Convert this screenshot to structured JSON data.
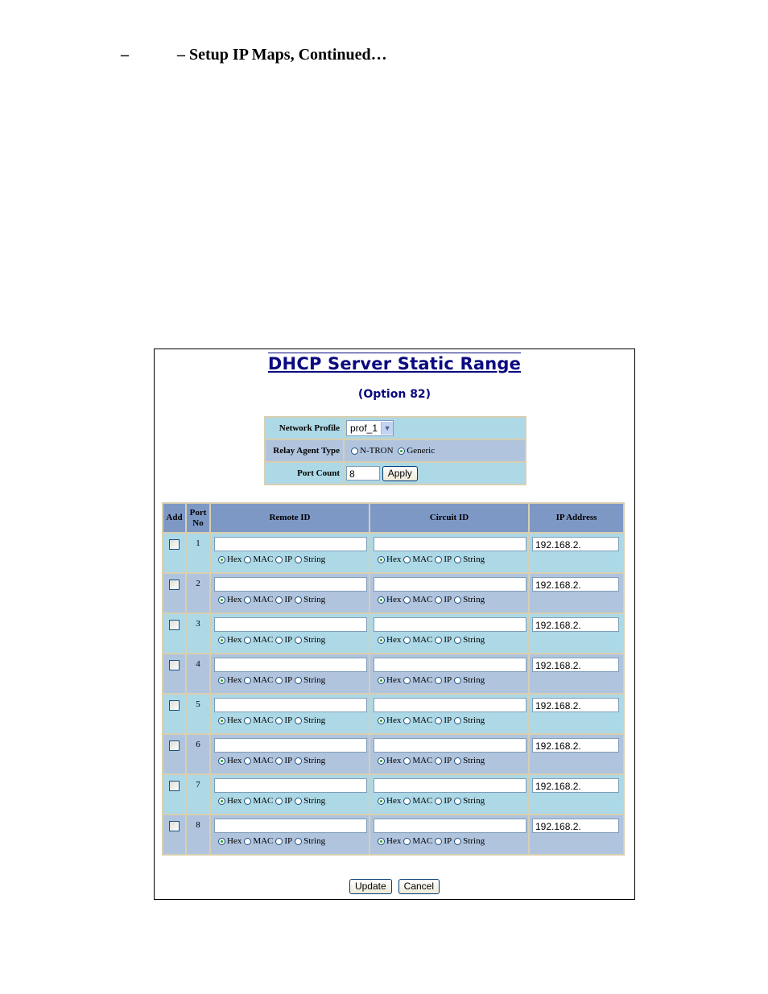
{
  "document": {
    "heading": "–            – Setup IP Maps, Continued…"
  },
  "panel": {
    "title": "DHCP Server Static Range",
    "subtitle": "(Option 82)",
    "config": {
      "network_profile_label": "Network Profile",
      "network_profile_value": "prof_1",
      "relay_agent_type_label": "Relay Agent Type",
      "relay_agent_options": [
        {
          "label": "N-TRON",
          "selected": false
        },
        {
          "label": "Generic",
          "selected": true
        }
      ],
      "port_count_label": "Port Count",
      "port_count_value": "8",
      "apply_label": "Apply"
    },
    "table": {
      "headers": {
        "add": "Add",
        "port_line1": "Port",
        "port_line2": "No",
        "remote_id": "Remote ID",
        "circuit_id": "Circuit ID",
        "ip_address": "IP Address"
      },
      "format_options": [
        "Hex",
        "MAC",
        "IP",
        "String"
      ],
      "rows": [
        {
          "port": "1",
          "add": false,
          "remote_id": "",
          "remote_format": "Hex",
          "circuit_id": "",
          "circuit_format": "Hex",
          "ip": "192.168.2."
        },
        {
          "port": "2",
          "add": false,
          "remote_id": "",
          "remote_format": "Hex",
          "circuit_id": "",
          "circuit_format": "Hex",
          "ip": "192.168.2."
        },
        {
          "port": "3",
          "add": false,
          "remote_id": "",
          "remote_format": "Hex",
          "circuit_id": "",
          "circuit_format": "Hex",
          "ip": "192.168.2."
        },
        {
          "port": "4",
          "add": false,
          "remote_id": "",
          "remote_format": "Hex",
          "circuit_id": "",
          "circuit_format": "Hex",
          "ip": "192.168.2."
        },
        {
          "port": "5",
          "add": false,
          "remote_id": "",
          "remote_format": "Hex",
          "circuit_id": "",
          "circuit_format": "Hex",
          "ip": "192.168.2."
        },
        {
          "port": "6",
          "add": false,
          "remote_id": "",
          "remote_format": "Hex",
          "circuit_id": "",
          "circuit_format": "Hex",
          "ip": "192.168.2."
        },
        {
          "port": "7",
          "add": false,
          "remote_id": "",
          "remote_format": "Hex",
          "circuit_id": "",
          "circuit_format": "Hex",
          "ip": "192.168.2."
        },
        {
          "port": "8",
          "add": false,
          "remote_id": "",
          "remote_format": "Hex",
          "circuit_id": "",
          "circuit_format": "Hex",
          "ip": "192.168.2."
        }
      ]
    },
    "update_label": "Update",
    "cancel_label": "Cancel"
  },
  "colors": {
    "title": "#0a0a80",
    "row_light": "#add8e6",
    "row_alt": "#b0c4de",
    "header": "#7e98c6",
    "grid": "#d8cfb0"
  }
}
